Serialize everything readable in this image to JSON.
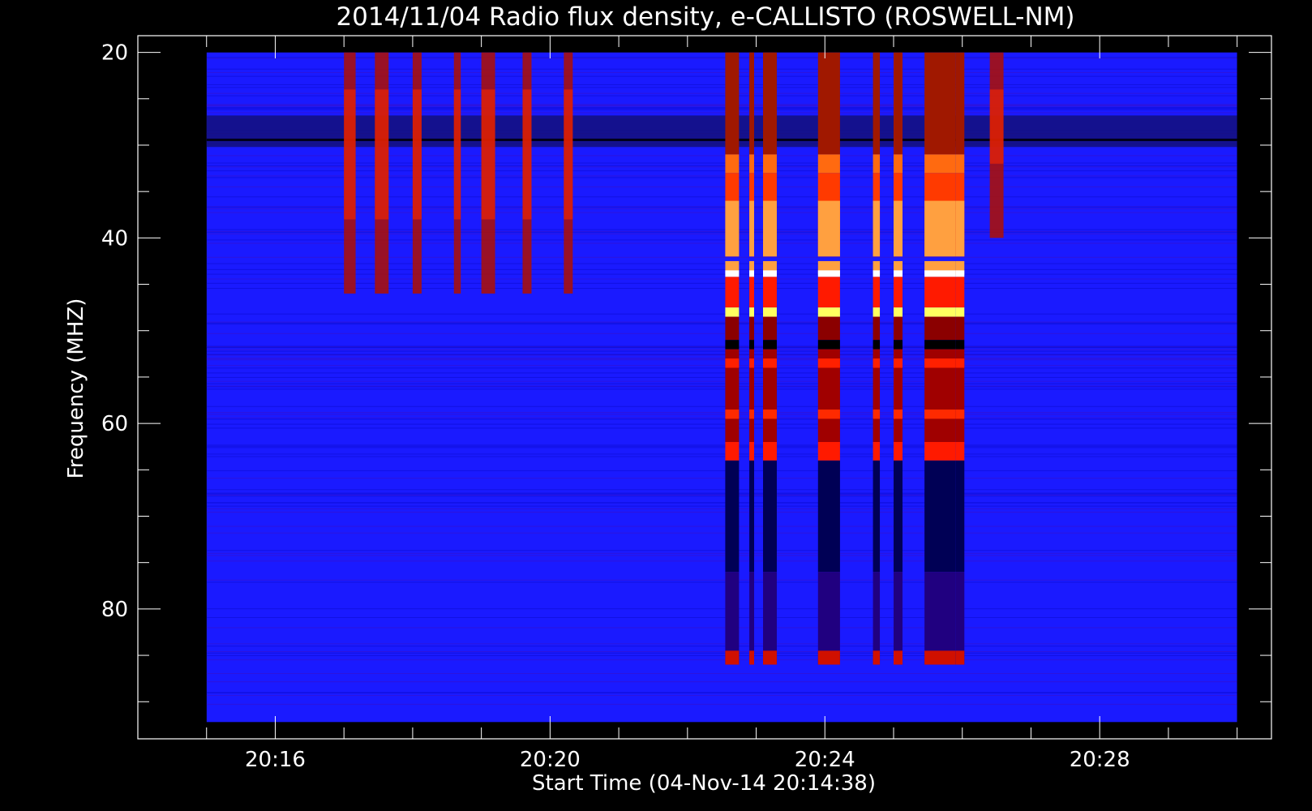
{
  "chart_data": {
    "type": "heatmap",
    "title": "2014/11/04  Radio flux density, e-CALLISTO (ROSWELL-NM)",
    "xlabel": "Start Time (04-Nov-14 20:14:38)",
    "ylabel": "Frequency (MHZ)",
    "x_range_minutes": [
      14.0,
      30.5
    ],
    "x_data_range_minutes": [
      15.0,
      30.0
    ],
    "ylim": [
      18.2,
      94
    ],
    "y_data_range": [
      20,
      92.2
    ],
    "y_inverted": true,
    "x_major_ticks": [
      16,
      20,
      24,
      28
    ],
    "x_minor_ticks": [
      15,
      17,
      18,
      19,
      21,
      22,
      23,
      25,
      26,
      27,
      29,
      30
    ],
    "x_tick_labels": [
      "20:16",
      "20:20",
      "20:24",
      "20:28"
    ],
    "y_major_ticks": [
      20,
      40,
      60,
      80
    ],
    "y_minor_ticks": [
      25,
      30,
      35,
      45,
      50,
      55,
      65,
      70,
      75,
      85,
      90
    ],
    "y_tick_labels": [
      "20",
      "40",
      "60",
      "80"
    ],
    "colormap": [
      "#000000",
      "#1414ff",
      "#8b0000",
      "#ff1a00",
      "#ffa040",
      "#ffffa0"
    ],
    "background_color": "#1a1aff",
    "weak_bursts": [
      {
        "t": 17.0,
        "w": 0.17,
        "f1": 20,
        "f2": 46
      },
      {
        "t": 17.45,
        "w": 0.2,
        "f1": 20,
        "f2": 46
      },
      {
        "t": 18.0,
        "w": 0.13,
        "f1": 20,
        "f2": 46
      },
      {
        "t": 18.6,
        "w": 0.1,
        "f1": 20,
        "f2": 46
      },
      {
        "t": 19.0,
        "w": 0.2,
        "f1": 20,
        "f2": 46
      },
      {
        "t": 19.6,
        "w": 0.13,
        "f1": 20,
        "f2": 46
      },
      {
        "t": 20.2,
        "w": 0.13,
        "f1": 20,
        "f2": 46
      },
      {
        "t": 26.4,
        "w": 0.2,
        "f1": 20,
        "f2": 40
      }
    ],
    "strong_bursts": [
      {
        "t": 22.55,
        "w": 0.2,
        "f1": 20,
        "f2": 86
      },
      {
        "t": 22.9,
        "w": 0.07,
        "f1": 20,
        "f2": 86
      },
      {
        "t": 23.1,
        "w": 0.2,
        "f1": 20,
        "f2": 86
      },
      {
        "t": 23.9,
        "w": 0.32,
        "f1": 20,
        "f2": 86
      },
      {
        "t": 24.7,
        "w": 0.1,
        "f1": 20,
        "f2": 86
      },
      {
        "t": 25.0,
        "w": 0.13,
        "f1": 20,
        "f2": 86
      },
      {
        "t": 25.45,
        "w": 0.45,
        "f1": 20,
        "f2": 86
      },
      {
        "t": 25.9,
        "w": 0.13,
        "f1": 20,
        "f2": 86
      }
    ]
  }
}
